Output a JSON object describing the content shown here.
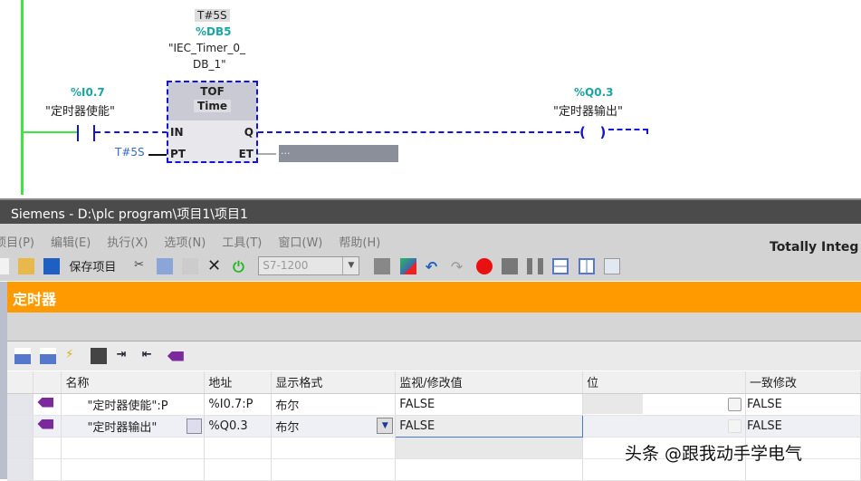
{
  "ladder": {
    "timer_preset_top": "T#5S",
    "db_address": "%DB5",
    "db_name_line1": "\"IEC_Timer_0_",
    "db_name_line2": "DB_1\"",
    "block_type": "TOF",
    "block_subtype": "Time",
    "pin_in": "IN",
    "pin_pt": "PT",
    "pin_q": "Q",
    "pin_et": "ET",
    "pt_value": "T#5S",
    "et_value": "...",
    "contact_address": "%I0.7",
    "contact_name": "\"定时器使能\"",
    "coil_address": "%Q0.3",
    "coil_name": "\"定时器输出\""
  },
  "window": {
    "title": "Siemens  -  D:\\plc program\\项目1\\项目1",
    "brand": "Totally Integ"
  },
  "menu": [
    "项目(P)",
    "编辑(E)",
    "执行(X)",
    "选项(N)",
    "工具(T)",
    "窗口(W)",
    "帮助(H)"
  ],
  "toolbar": {
    "save_label": "保存项目",
    "cpu_select": "S7-1200"
  },
  "panel": {
    "title": "定时器"
  },
  "table": {
    "headers": [
      "名称",
      "地址",
      "显示格式",
      "监视/修改值",
      "位",
      "一致修改"
    ],
    "rows": [
      {
        "name": "\"定时器使能\":P",
        "address": "%I0.7:P",
        "format": "布尔",
        "value": "FALSE",
        "consistent": "FALSE"
      },
      {
        "name": "\"定时器输出\"",
        "address": "%Q0.3",
        "format": "布尔",
        "value": "FALSE",
        "consistent": "FALSE"
      }
    ]
  },
  "watermark": "头条 @跟我动手学电气"
}
